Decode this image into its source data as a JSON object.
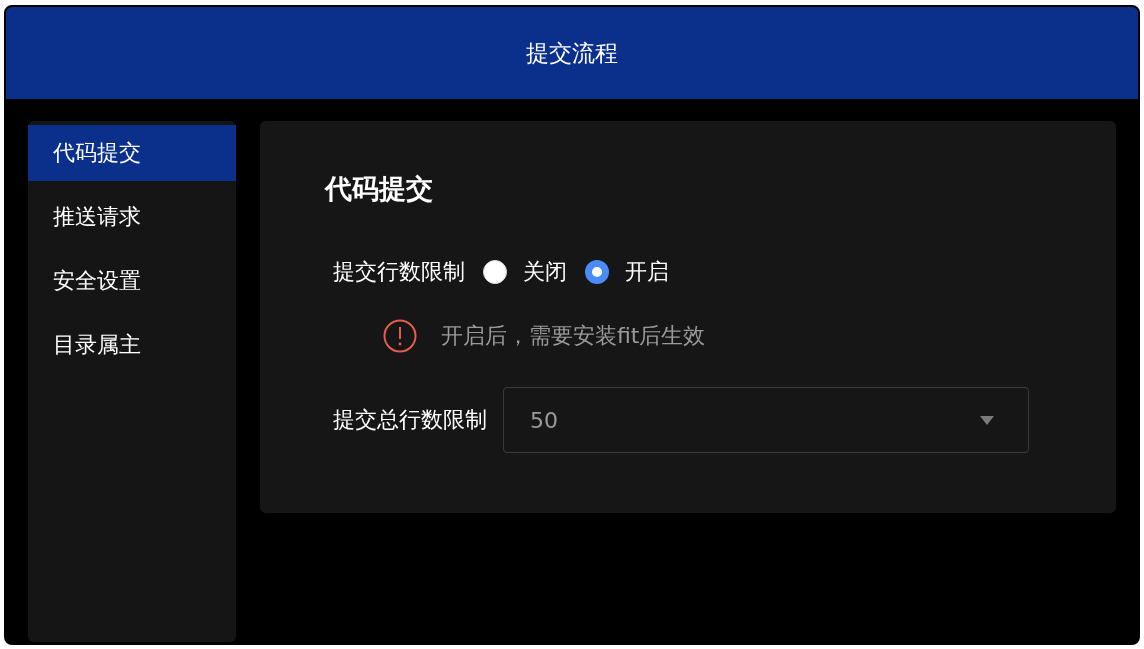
{
  "window": {
    "title": "提交流程"
  },
  "sidebar": {
    "items": [
      {
        "label": "代码提交",
        "selected": true
      },
      {
        "label": "推送请求",
        "selected": false
      },
      {
        "label": "安全设置",
        "selected": false
      },
      {
        "label": "目录属主",
        "selected": false
      }
    ]
  },
  "panel": {
    "heading": "代码提交",
    "line_limit": {
      "label": "提交行数限制",
      "options": [
        {
          "label": "关闭",
          "selected": false
        },
        {
          "label": "开启",
          "selected": true
        }
      ]
    },
    "warning": "开启后，需要安装fit后生效",
    "total_limit": {
      "label": "提交总行数限制",
      "value": "50"
    }
  }
}
